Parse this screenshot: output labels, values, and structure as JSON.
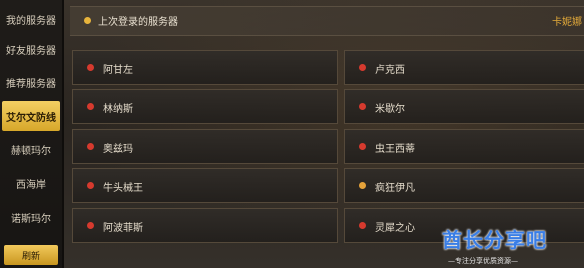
{
  "sidebar": {
    "items": [
      {
        "label": "我的服务器"
      },
      {
        "label": "好友服务器"
      },
      {
        "label": "推荐服务器"
      },
      {
        "label": "艾尔文防线"
      },
      {
        "label": "赫顿玛尔"
      },
      {
        "label": "西海岸"
      },
      {
        "label": "诺斯玛尔"
      }
    ],
    "active_index": 3,
    "refresh_label": "刷新"
  },
  "header": {
    "title": "上次登录的服务器",
    "last_server": "卡妮娜"
  },
  "servers": [
    {
      "name": "阿甘左",
      "status_color": "#d63a2e"
    },
    {
      "name": "卢克西",
      "status_color": "#d63a2e"
    },
    {
      "name": "林纳斯",
      "status_color": "#d63a2e"
    },
    {
      "name": "米歇尔",
      "status_color": "#d63a2e"
    },
    {
      "name": "奥兹玛",
      "status_color": "#d63a2e"
    },
    {
      "name": "虫王西蒂",
      "status_color": "#d63a2e"
    },
    {
      "name": "牛头械王",
      "status_color": "#d63a2e"
    },
    {
      "name": "疯狂伊凡",
      "status_color": "#e5a23a"
    },
    {
      "name": "阿波菲斯",
      "status_color": "#d63a2e"
    },
    {
      "name": "灵犀之心",
      "status_color": "#d63a2e"
    }
  ],
  "watermark": {
    "logo": "酋长分享吧",
    "tagline": "—专注分享优质资源—"
  }
}
